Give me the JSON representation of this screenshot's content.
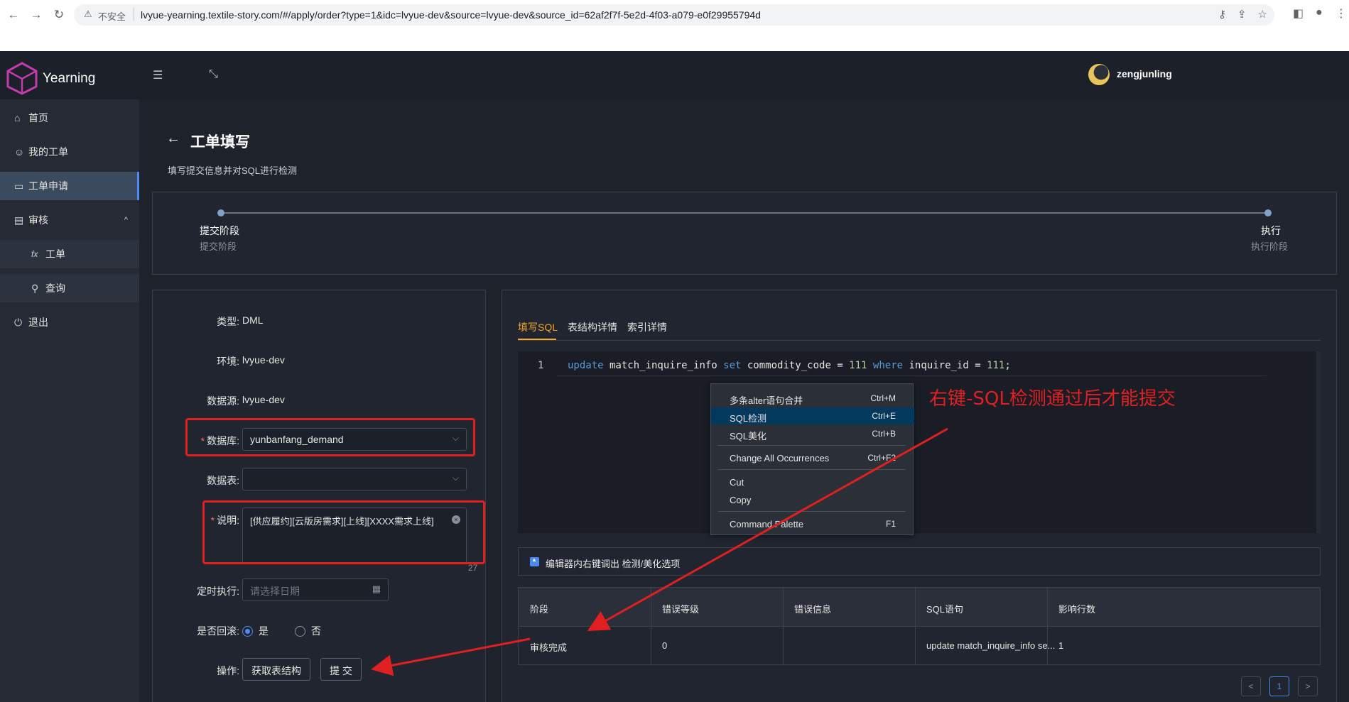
{
  "browser": {
    "back_icon": "←",
    "forward_icon": "→",
    "reload_icon": "↻",
    "warn_icon": "⚠",
    "insecure_label": "不安全",
    "url": "lvyue-yearning.textile-story.com/#/apply/order?type=1&idc=lvyue-dev&source=lvyue-dev&source_id=62af2f7f-5e2d-4f03-a079-e0f29955794d"
  },
  "app": {
    "name": "Yearning",
    "username": "zengjunling"
  },
  "sidebar": {
    "items": [
      {
        "icon": "⌂",
        "label": "首页"
      },
      {
        "icon": "☺",
        "label": "我的工单"
      },
      {
        "icon": "▭",
        "label": "工单申请"
      },
      {
        "icon": "▤",
        "label": "审核"
      },
      {
        "icon": "fx",
        "label": "工单"
      },
      {
        "icon": "⚲",
        "label": "查询"
      },
      {
        "icon": "⏻",
        "label": "退出"
      }
    ],
    "caret": "^"
  },
  "page": {
    "title": "工单填写",
    "subtitle": "填写提交信息并对SQL进行检测"
  },
  "steps": [
    {
      "title": "提交阶段",
      "desc": "提交阶段"
    },
    {
      "title": "执行",
      "desc": "执行阶段"
    }
  ],
  "form": {
    "type_label": "类型:",
    "type_value": "DML",
    "env_label": "环境:",
    "env_value": "lvyue-dev",
    "source_label": "数据源:",
    "source_value": "lvyue-dev",
    "db_label": "数据库:",
    "db_value": "yunbanfang_demand",
    "table_label": "数据表:",
    "table_value": "",
    "desc_label": "说明:",
    "desc_value": "[供应履约][云版房需求][上线][XXXX需求上线]",
    "desc_count": "27",
    "schedule_label": "定时执行:",
    "schedule_placeholder": "请选择日期",
    "rollback_label": "是否回滚:",
    "rollback_yes": "是",
    "rollback_no": "否",
    "rollback_selected": "是",
    "ops_label": "操作:",
    "btn_fetch": "获取表结构",
    "btn_submit": "提 交"
  },
  "tabs": [
    {
      "label": "填写SQL",
      "active": true
    },
    {
      "label": "表结构详情",
      "active": false
    },
    {
      "label": "索引详情",
      "active": false
    }
  ],
  "editor": {
    "line_number": "1",
    "tokens": [
      {
        "t": "update",
        "c": "kw"
      },
      {
        "t": " match_inquire_info ",
        "c": ""
      },
      {
        "t": "set",
        "c": "kw"
      },
      {
        "t": " commodity_code = ",
        "c": ""
      },
      {
        "t": "111",
        "c": "num"
      },
      {
        "t": " ",
        "c": ""
      },
      {
        "t": "where",
        "c": "kw"
      },
      {
        "t": " inquire_id = ",
        "c": ""
      },
      {
        "t": "111",
        "c": "num"
      },
      {
        "t": ";",
        "c": ""
      }
    ]
  },
  "context_menu": {
    "items": [
      {
        "label": "多条alter语句合并",
        "shortcut": "Ctrl+M",
        "highlighted": false
      },
      {
        "label": "SQL检测",
        "shortcut": "Ctrl+E",
        "highlighted": true
      },
      {
        "label": "SQL美化",
        "shortcut": "Ctrl+B",
        "highlighted": false
      },
      {
        "label": "Change All Occurrences",
        "shortcut": "Ctrl+F2",
        "highlighted": false
      },
      {
        "label": "Cut",
        "shortcut": "",
        "highlighted": false
      },
      {
        "label": "Copy",
        "shortcut": "",
        "highlighted": false
      },
      {
        "label": "Command Palette",
        "shortcut": "F1",
        "highlighted": false
      }
    ]
  },
  "annotation": "右键-SQL检测通过后才能提交",
  "hint": "编辑器内右键调出 检测/美化选项",
  "result_table": {
    "columns": [
      "阶段",
      "错误等级",
      "错误信息",
      "SQL语句",
      "影响行数"
    ],
    "rows": [
      [
        "审核完成",
        "0",
        "",
        "update match_inquire_info se...",
        "1"
      ]
    ]
  },
  "pagination": {
    "prev": "<",
    "current": "1",
    "next": ">"
  },
  "colors": {
    "accent": "#f5a623",
    "primary": "#4c8bf5",
    "annotation_red": "#e02020",
    "background": "#1e222b"
  }
}
